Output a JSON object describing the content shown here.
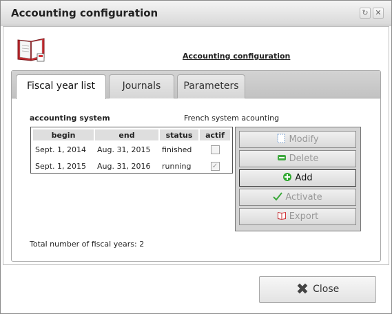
{
  "window": {
    "title": "Accounting configuration",
    "controls": {
      "refresh_glyph": "↻",
      "close_glyph": "✕"
    }
  },
  "header": {
    "title": "Accounting configuration",
    "icon": "accounting-book-icon"
  },
  "tabs": [
    {
      "label": "Fiscal year list",
      "active": true
    },
    {
      "label": "Journals",
      "active": false
    },
    {
      "label": "Parameters",
      "active": false
    }
  ],
  "accounting_system": {
    "label": "accounting system",
    "value": "French system acounting"
  },
  "fiscal_years": {
    "columns": [
      "begin",
      "end",
      "status",
      "actif"
    ],
    "rows": [
      {
        "begin": "Sept. 1, 2014",
        "end": "Aug. 31, 2015",
        "status": "finished",
        "actif": false
      },
      {
        "begin": "Sept. 1, 2015",
        "end": "Aug. 31, 2016",
        "status": "running",
        "actif": true
      }
    ]
  },
  "actions": [
    {
      "label": "Modify",
      "icon": "modify-icon",
      "enabled": false
    },
    {
      "label": "Delete",
      "icon": "delete-icon",
      "enabled": false
    },
    {
      "label": "Add",
      "icon": "add-icon",
      "enabled": true
    },
    {
      "label": "Activate",
      "icon": "checkmark-icon",
      "enabled": false
    },
    {
      "label": "Export",
      "icon": "export-icon",
      "enabled": false
    }
  ],
  "total_text": "Total number of fiscal years: 2",
  "footer": {
    "close_label": "Close",
    "close_icon": "close-x-icon"
  },
  "colors": {
    "add_icon": "#2fa82f",
    "delete_icon": "#3fa83f",
    "activate_icon": "#3aa83a",
    "book_cover": "#c0282d"
  }
}
